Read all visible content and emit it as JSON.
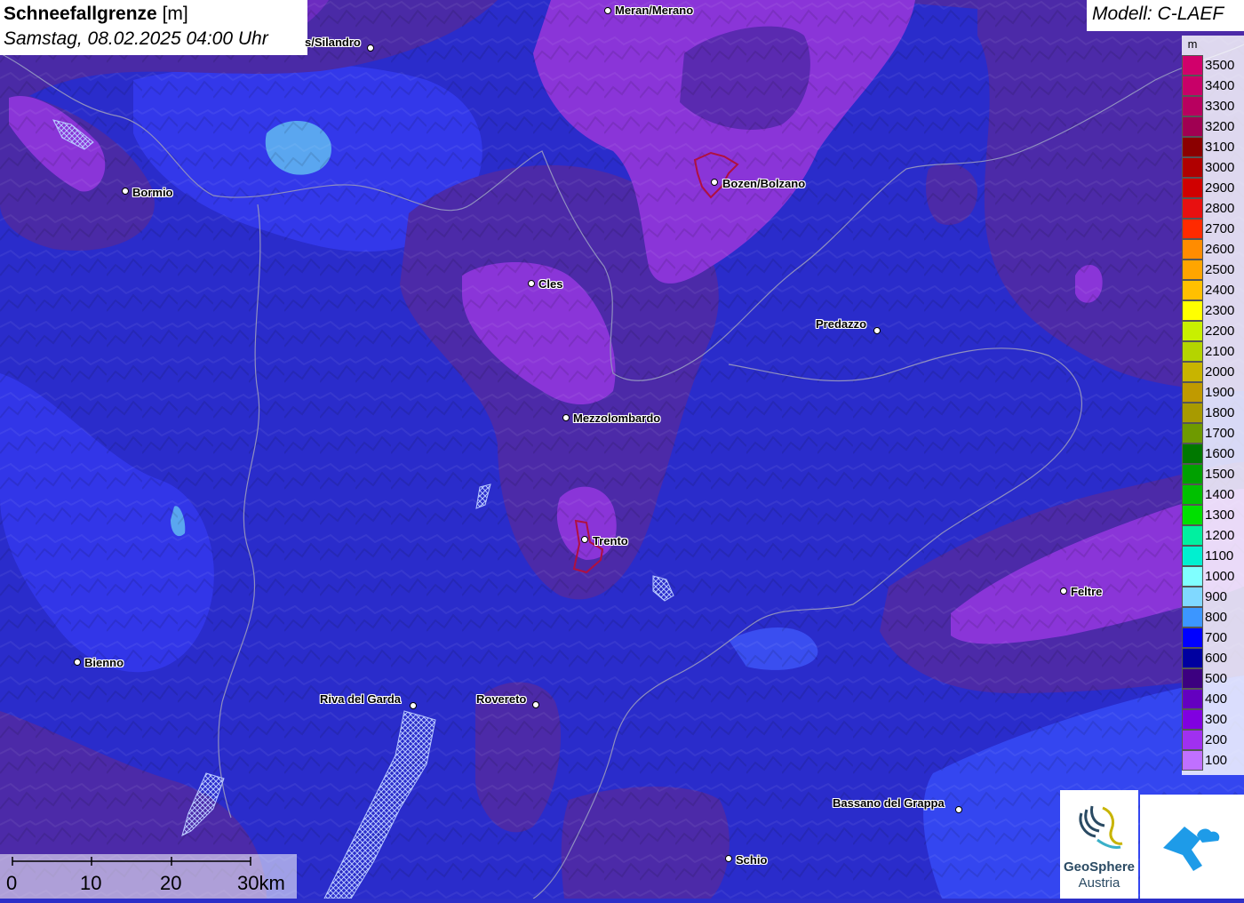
{
  "header": {
    "title": "Schneefallgrenze",
    "unit": "[m]",
    "datetime": "Samstag, 08.02.2025 04:00 Uhr"
  },
  "model": {
    "label": "Modell: C-LAEF"
  },
  "legend": {
    "unit": "m",
    "entries": [
      {
        "label": "3500",
        "color": "#d1006b"
      },
      {
        "label": "3400",
        "color": "#c80068"
      },
      {
        "label": "3300",
        "color": "#b8005f"
      },
      {
        "label": "3200",
        "color": "#a00052"
      },
      {
        "label": "3100",
        "color": "#8b0000"
      },
      {
        "label": "3000",
        "color": "#b00000"
      },
      {
        "label": "2900",
        "color": "#d00000"
      },
      {
        "label": "2800",
        "color": "#e81010"
      },
      {
        "label": "2700",
        "color": "#ff2a00"
      },
      {
        "label": "2600",
        "color": "#ff8c00"
      },
      {
        "label": "2500",
        "color": "#ffa500"
      },
      {
        "label": "2400",
        "color": "#ffc000"
      },
      {
        "label": "2300",
        "color": "#ffff00"
      },
      {
        "label": "2200",
        "color": "#c8f000"
      },
      {
        "label": "2100",
        "color": "#b4d400"
      },
      {
        "label": "2000",
        "color": "#c8b400"
      },
      {
        "label": "1900",
        "color": "#c09a00"
      },
      {
        "label": "1800",
        "color": "#a89a00"
      },
      {
        "label": "1700",
        "color": "#6e9a00"
      },
      {
        "label": "1600",
        "color": "#007800"
      },
      {
        "label": "1500",
        "color": "#00a000"
      },
      {
        "label": "1400",
        "color": "#00c000"
      },
      {
        "label": "1300",
        "color": "#00e000"
      },
      {
        "label": "1200",
        "color": "#00f0a0"
      },
      {
        "label": "1100",
        "color": "#00f0d0"
      },
      {
        "label": "1000",
        "color": "#80ffff"
      },
      {
        "label": "900",
        "color": "#80d8ff"
      },
      {
        "label": "800",
        "color": "#3c96ff"
      },
      {
        "label": "700",
        "color": "#0000ff"
      },
      {
        "label": "600",
        "color": "#0000a0"
      },
      {
        "label": "500",
        "color": "#3c0080"
      },
      {
        "label": "400",
        "color": "#6400c0"
      },
      {
        "label": "300",
        "color": "#8000e0"
      },
      {
        "label": "200",
        "color": "#a030f0"
      },
      {
        "label": "100",
        "color": "#c070ff"
      }
    ]
  },
  "cities": [
    {
      "name": "Meran/Merano"
    },
    {
      "name": "s/Silandro"
    },
    {
      "name": "Bormio"
    },
    {
      "name": "Bozen/Bolzano"
    },
    {
      "name": "Cles"
    },
    {
      "name": "Predazzo"
    },
    {
      "name": "Mezzolombardo"
    },
    {
      "name": "Trento"
    },
    {
      "name": "Feltre"
    },
    {
      "name": "Bienno"
    },
    {
      "name": "Riva del Garda"
    },
    {
      "name": "Rovereto"
    },
    {
      "name": "Bassano del Grappa"
    },
    {
      "name": "Schio"
    }
  ],
  "scale": {
    "ticks": [
      "0",
      "10",
      "20",
      "30km"
    ]
  },
  "logos": {
    "geosphere_line1": "GeoSphere",
    "geosphere_line2": "Austria"
  }
}
